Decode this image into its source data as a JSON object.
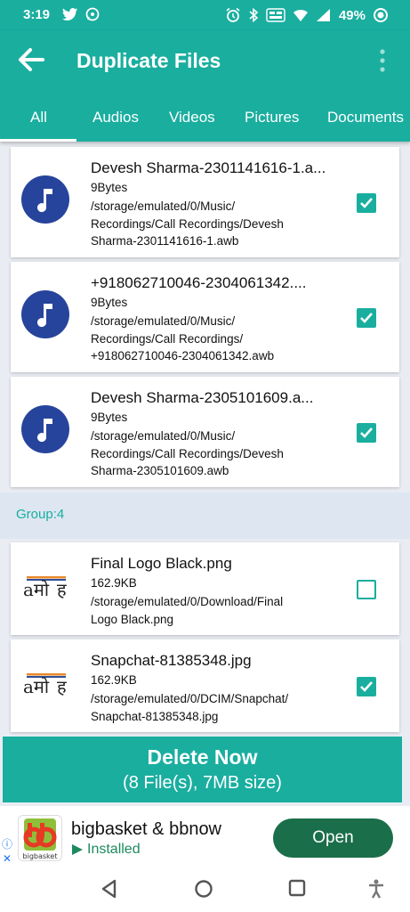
{
  "status_bar": {
    "time": "3:19",
    "battery": "49%",
    "left_icons": [
      "twitter-icon",
      "whatsapp-icon"
    ],
    "right_icons": [
      "alarm-icon",
      "bluetooth-icon",
      "volte-icon",
      "wifi-icon",
      "signal-icon",
      "battery-icon"
    ]
  },
  "app_bar": {
    "title": "Duplicate Files",
    "back_icon": "arrow-left-icon",
    "menu_icon": "overflow-menu-icon"
  },
  "tabs": [
    {
      "label": "All",
      "selected": true
    },
    {
      "label": "Audios",
      "selected": false
    },
    {
      "label": "Videos",
      "selected": false
    },
    {
      "label": "Pictures",
      "selected": false
    },
    {
      "label": "Documents",
      "selected": false
    }
  ],
  "files_audio": [
    {
      "name": "Devesh Sharma-2301141616-1.a...",
      "size": "9Bytes",
      "path": "/storage/emulated/0/Music/\nRecordings/Call Recordings/Devesh\nSharma-2301141616-1.awb",
      "checked": true,
      "icon": "music-note-icon"
    },
    {
      "name": "+918062710046-2304061342....",
      "size": "9Bytes",
      "path": "/storage/emulated/0/Music/\nRecordings/Call Recordings/\n+918062710046-2304061342.awb",
      "checked": true,
      "icon": "music-note-icon"
    },
    {
      "name": "Devesh Sharma-2305101609.a...",
      "size": "9Bytes",
      "path": "/storage/emulated/0/Music/\nRecordings/Call Recordings/Devesh\nSharma-2305101609.awb",
      "checked": true,
      "icon": "music-note-icon"
    }
  ],
  "group": {
    "label": "Group:4"
  },
  "files_image": [
    {
      "name": "Final Logo Black.png",
      "size": "162.9KB",
      "path": "/storage/emulated/0/Download/Final\nLogo Black.png",
      "checked": false,
      "icon": "image-thumbnail-icon"
    },
    {
      "name": "Snapchat-81385348.jpg",
      "size": "162.9KB",
      "path": "/storage/emulated/0/DCIM/Snapchat/\nSnapchat-81385348.jpg",
      "checked": true,
      "icon": "image-thumbnail-icon"
    }
  ],
  "delete_button": {
    "label": "Delete Now",
    "summary": "(8 File(s), 7MB size)"
  },
  "ad": {
    "title": "bigbasket & bbnow",
    "status": "Installed",
    "cta": "Open",
    "logo_text": "bigbasket",
    "info_icon": "info-icon",
    "close_icon": "close-icon"
  },
  "colors": {
    "primary": "#1aae9f",
    "icon_bg": "#27449c",
    "group_bg": "#dde6f1",
    "ad_button": "#1a6e4a"
  }
}
